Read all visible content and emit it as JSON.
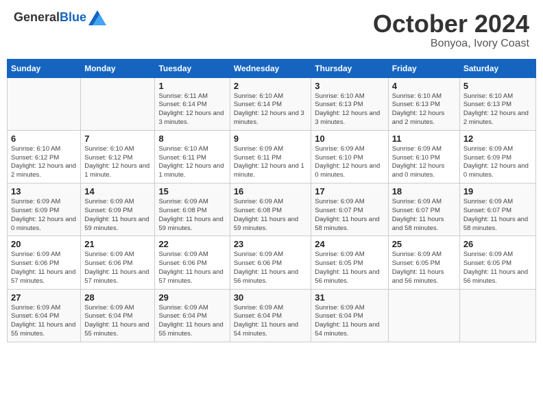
{
  "header": {
    "logo_general": "General",
    "logo_blue": "Blue",
    "month": "October 2024",
    "location": "Bonyoa, Ivory Coast"
  },
  "days_of_week": [
    "Sunday",
    "Monday",
    "Tuesday",
    "Wednesday",
    "Thursday",
    "Friday",
    "Saturday"
  ],
  "weeks": [
    [
      {
        "day": null
      },
      {
        "day": null
      },
      {
        "day": "1",
        "sunrise": "6:11 AM",
        "sunset": "6:14 PM",
        "daylight": "12 hours and 3 minutes."
      },
      {
        "day": "2",
        "sunrise": "6:10 AM",
        "sunset": "6:14 PM",
        "daylight": "12 hours and 3 minutes."
      },
      {
        "day": "3",
        "sunrise": "6:10 AM",
        "sunset": "6:13 PM",
        "daylight": "12 hours and 3 minutes."
      },
      {
        "day": "4",
        "sunrise": "6:10 AM",
        "sunset": "6:13 PM",
        "daylight": "12 hours and 2 minutes."
      },
      {
        "day": "5",
        "sunrise": "6:10 AM",
        "sunset": "6:13 PM",
        "daylight": "12 hours and 2 minutes."
      }
    ],
    [
      {
        "day": "6",
        "sunrise": "6:10 AM",
        "sunset": "6:12 PM",
        "daylight": "12 hours and 2 minutes."
      },
      {
        "day": "7",
        "sunrise": "6:10 AM",
        "sunset": "6:12 PM",
        "daylight": "12 hours and 1 minute."
      },
      {
        "day": "8",
        "sunrise": "6:10 AM",
        "sunset": "6:11 PM",
        "daylight": "12 hours and 1 minute."
      },
      {
        "day": "9",
        "sunrise": "6:09 AM",
        "sunset": "6:11 PM",
        "daylight": "12 hours and 1 minute."
      },
      {
        "day": "10",
        "sunrise": "6:09 AM",
        "sunset": "6:10 PM",
        "daylight": "12 hours and 0 minutes."
      },
      {
        "day": "11",
        "sunrise": "6:09 AM",
        "sunset": "6:10 PM",
        "daylight": "12 hours and 0 minutes."
      },
      {
        "day": "12",
        "sunrise": "6:09 AM",
        "sunset": "6:09 PM",
        "daylight": "12 hours and 0 minutes."
      }
    ],
    [
      {
        "day": "13",
        "sunrise": "6:09 AM",
        "sunset": "6:09 PM",
        "daylight": "12 hours and 0 minutes."
      },
      {
        "day": "14",
        "sunrise": "6:09 AM",
        "sunset": "6:09 PM",
        "daylight": "11 hours and 59 minutes."
      },
      {
        "day": "15",
        "sunrise": "6:09 AM",
        "sunset": "6:08 PM",
        "daylight": "11 hours and 59 minutes."
      },
      {
        "day": "16",
        "sunrise": "6:09 AM",
        "sunset": "6:08 PM",
        "daylight": "11 hours and 59 minutes."
      },
      {
        "day": "17",
        "sunrise": "6:09 AM",
        "sunset": "6:07 PM",
        "daylight": "11 hours and 58 minutes."
      },
      {
        "day": "18",
        "sunrise": "6:09 AM",
        "sunset": "6:07 PM",
        "daylight": "11 hours and 58 minutes."
      },
      {
        "day": "19",
        "sunrise": "6:09 AM",
        "sunset": "6:07 PM",
        "daylight": "11 hours and 58 minutes."
      }
    ],
    [
      {
        "day": "20",
        "sunrise": "6:09 AM",
        "sunset": "6:06 PM",
        "daylight": "11 hours and 57 minutes."
      },
      {
        "day": "21",
        "sunrise": "6:09 AM",
        "sunset": "6:06 PM",
        "daylight": "11 hours and 57 minutes."
      },
      {
        "day": "22",
        "sunrise": "6:09 AM",
        "sunset": "6:06 PM",
        "daylight": "11 hours and 57 minutes."
      },
      {
        "day": "23",
        "sunrise": "6:09 AM",
        "sunset": "6:06 PM",
        "daylight": "11 hours and 56 minutes."
      },
      {
        "day": "24",
        "sunrise": "6:09 AM",
        "sunset": "6:05 PM",
        "daylight": "11 hours and 56 minutes."
      },
      {
        "day": "25",
        "sunrise": "6:09 AM",
        "sunset": "6:05 PM",
        "daylight": "11 hours and 56 minutes."
      },
      {
        "day": "26",
        "sunrise": "6:09 AM",
        "sunset": "6:05 PM",
        "daylight": "11 hours and 56 minutes."
      }
    ],
    [
      {
        "day": "27",
        "sunrise": "6:09 AM",
        "sunset": "6:04 PM",
        "daylight": "11 hours and 55 minutes."
      },
      {
        "day": "28",
        "sunrise": "6:09 AM",
        "sunset": "6:04 PM",
        "daylight": "11 hours and 55 minutes."
      },
      {
        "day": "29",
        "sunrise": "6:09 AM",
        "sunset": "6:04 PM",
        "daylight": "11 hours and 55 minutes."
      },
      {
        "day": "30",
        "sunrise": "6:09 AM",
        "sunset": "6:04 PM",
        "daylight": "11 hours and 54 minutes."
      },
      {
        "day": "31",
        "sunrise": "6:09 AM",
        "sunset": "6:04 PM",
        "daylight": "11 hours and 54 minutes."
      },
      {
        "day": null
      },
      {
        "day": null
      }
    ]
  ],
  "labels": {
    "sunrise_prefix": "Sunrise: ",
    "sunset_prefix": "Sunset: ",
    "daylight_prefix": "Daylight: "
  }
}
